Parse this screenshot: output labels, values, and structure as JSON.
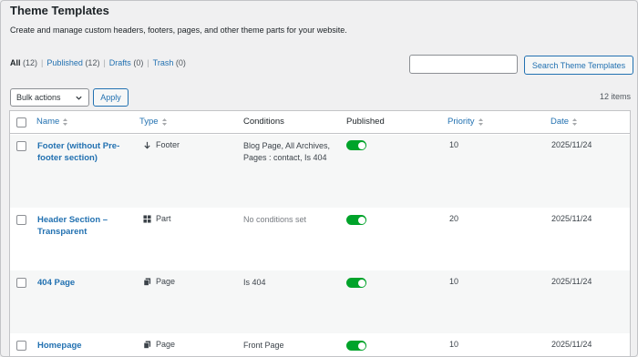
{
  "header": {
    "title": "Theme Templates",
    "description": "Create and manage custom headers, footers, pages, and other theme parts for your website."
  },
  "filters": {
    "all_label": "All",
    "all_count": "(12)",
    "published_label": "Published",
    "published_count": "(12)",
    "drafts_label": "Drafts",
    "drafts_count": "(0)",
    "trash_label": "Trash",
    "trash_count": "(0)",
    "separator": "|"
  },
  "search": {
    "value": "",
    "button_label": "Search Theme Templates"
  },
  "bulk": {
    "selected": "Bulk actions",
    "apply_label": "Apply",
    "items_count": "12 items"
  },
  "table": {
    "columns": {
      "name": "Name",
      "type": "Type",
      "conditions": "Conditions",
      "published": "Published",
      "priority": "Priority",
      "date": "Date"
    },
    "rows": [
      {
        "name": "Footer (without Pre-footer section)",
        "type_icon": "arrow-down-icon",
        "type": "Footer",
        "conditions": "Blog Page, All Archives, Pages : contact, Is 404",
        "published": true,
        "priority": "10",
        "date": "2025/11/24"
      },
      {
        "name": "Header Section – Transparent",
        "type_icon": "grid-icon",
        "type": "Part",
        "conditions": "No conditions set",
        "published": true,
        "priority": "20",
        "date": "2025/11/24"
      },
      {
        "name": "404 Page",
        "type_icon": "page-icon",
        "type": "Page",
        "conditions": "Is 404",
        "published": true,
        "priority": "10",
        "date": "2025/11/24"
      },
      {
        "name": "Homepage",
        "type_icon": "page-icon",
        "type": "Page",
        "conditions": "Front Page",
        "published": true,
        "priority": "10",
        "date": "2025/11/24"
      }
    ]
  },
  "colors": {
    "link": "#2271b1",
    "toggle_on": "#00a32a",
    "row_alt": "#f6f7f7"
  }
}
